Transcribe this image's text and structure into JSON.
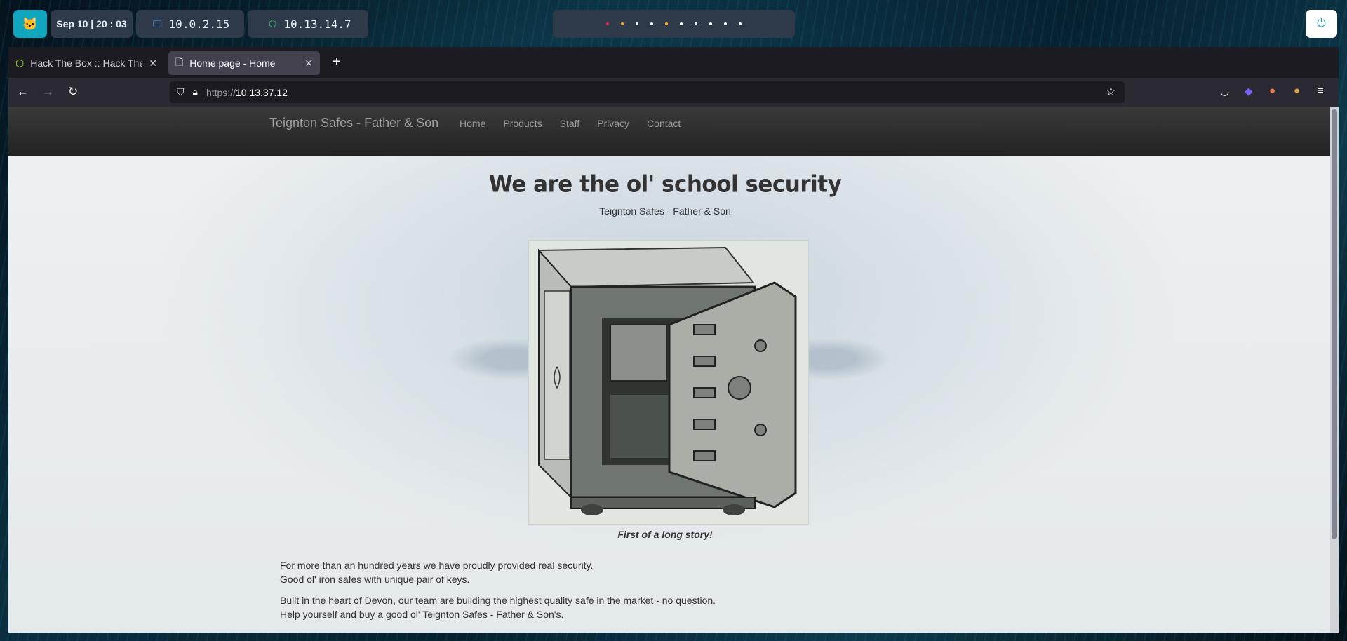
{
  "topbar": {
    "menu_icon": "cat-icon",
    "clock": {
      "date": "Sep 10",
      "time": "20 : 03"
    },
    "ip_local": "10.0.2.15",
    "ip_vpn": "10.13.14.7",
    "workspaces": [
      "#e0245e",
      "#f0b429",
      "#ffffff",
      "#ffffff",
      "#f0b429",
      "#ffffff",
      "#ffffff",
      "#ffffff",
      "#ffffff",
      "#ffffff"
    ],
    "power_icon": "power-icon"
  },
  "browser": {
    "tabs": [
      {
        "title": "Hack The Box :: Hack The",
        "active": false
      },
      {
        "title": "Home page - Home",
        "active": true
      }
    ],
    "url": {
      "scheme": "https://",
      "host": "10.13.37.12"
    }
  },
  "site": {
    "brand": "Teignton Safes - Father & Son",
    "nav": [
      "Home",
      "Products",
      "Staff",
      "Privacy",
      "Contact"
    ],
    "hero": {
      "title": "We are the ol' school security",
      "subtitle": "Teignton Safes - Father & Son",
      "caption": "First of a long story!"
    },
    "paragraphs": [
      [
        "For more than an hundred years we have proudly provided real security.",
        "Good ol' iron safes with unique pair of keys."
      ],
      [
        "Built in the heart of Devon, our team are building the highest quality safe in the market - no question.",
        "Help yourself and buy a good ol' Teignton Safes - Father & Son's."
      ]
    ]
  },
  "colors": {
    "accent": "#10a6bd",
    "panel": "#2e3a4a",
    "site_nav": "#222222"
  }
}
